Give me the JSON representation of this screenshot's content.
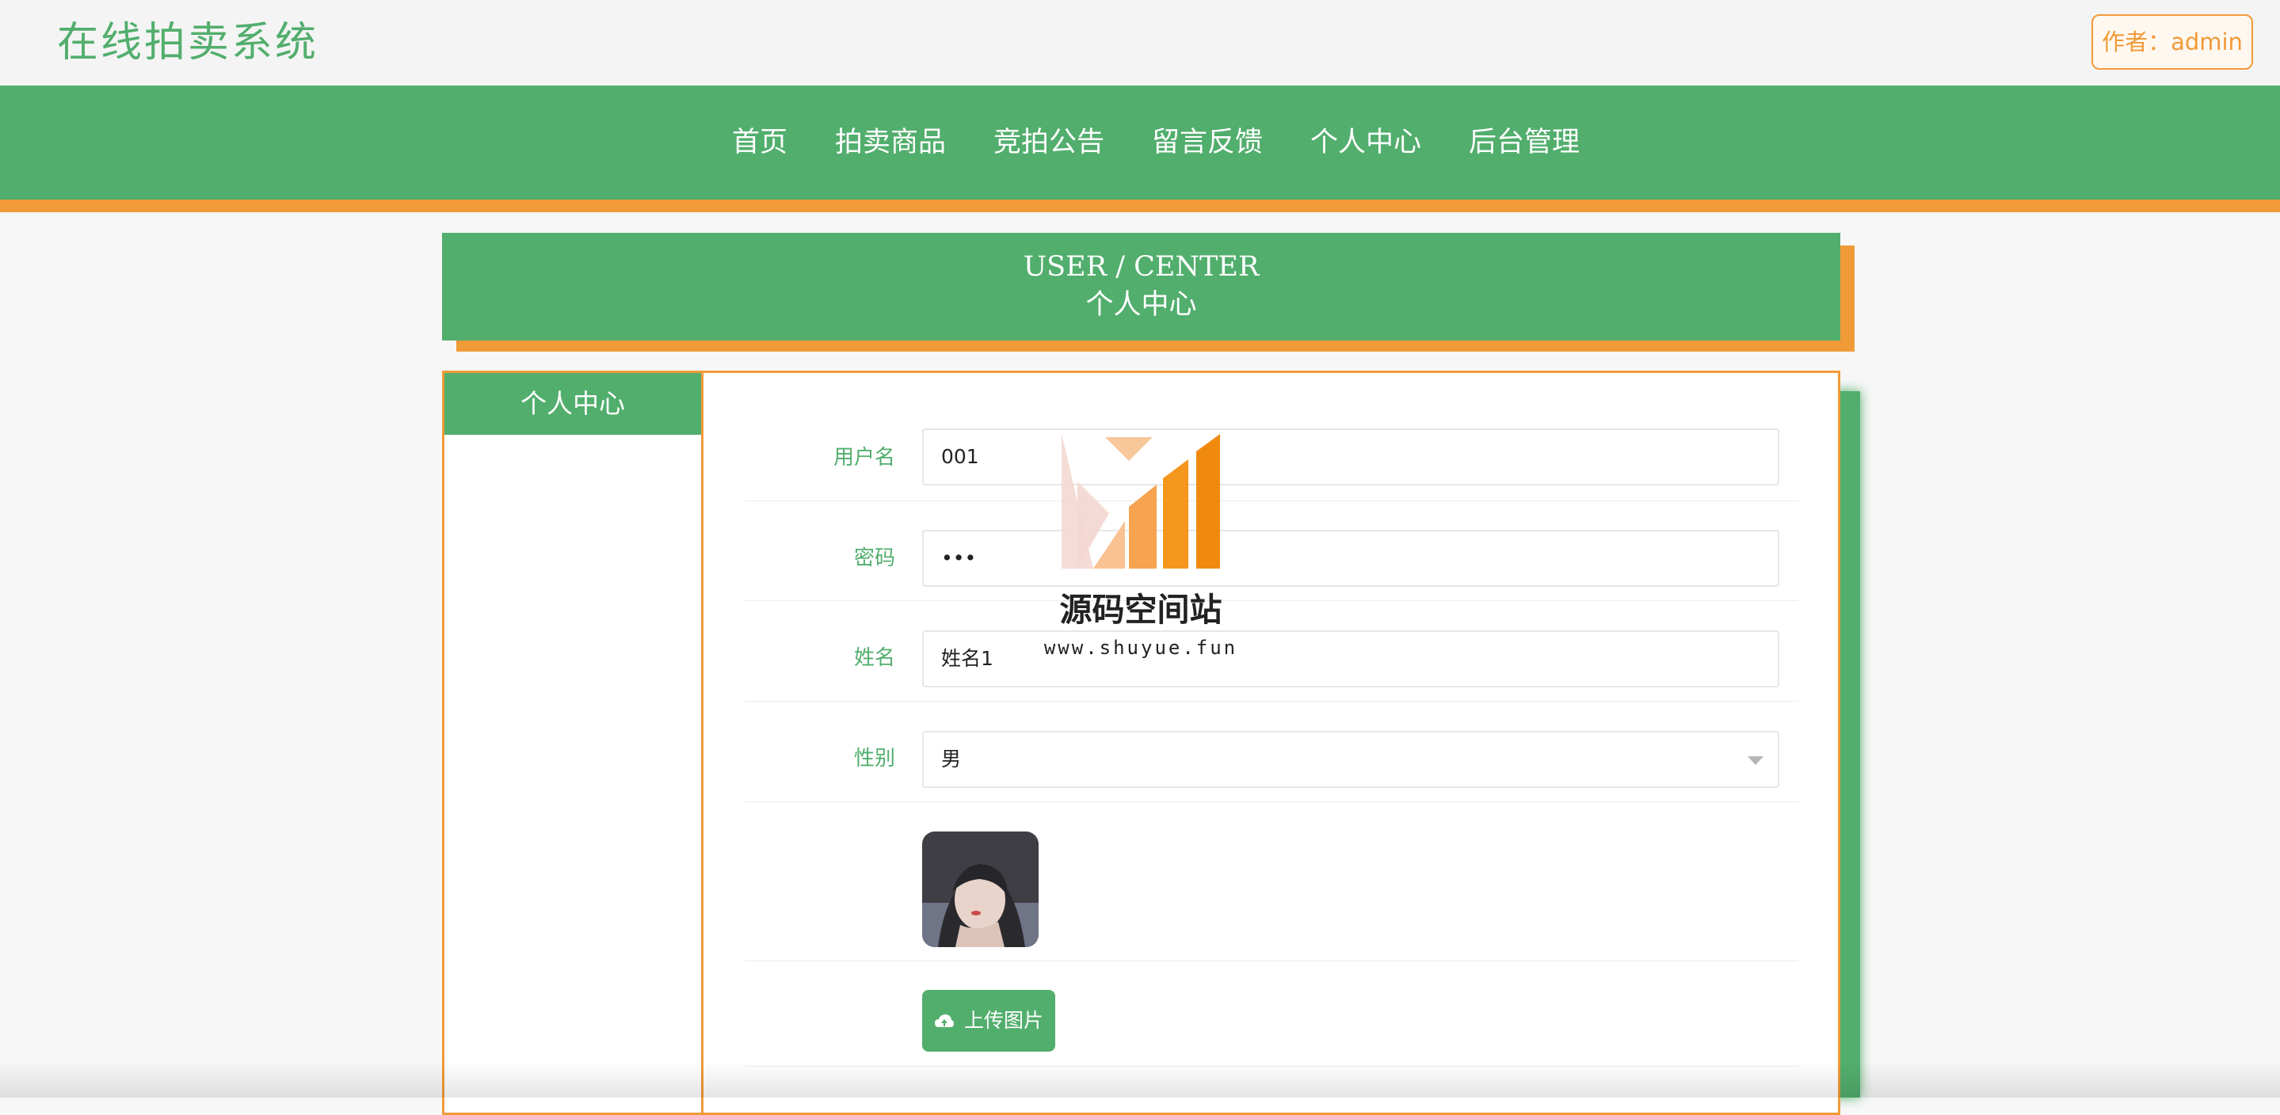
{
  "header": {
    "site_title": "在线拍卖系统",
    "author_label": "作者：admin"
  },
  "nav": {
    "items": [
      "首页",
      "拍卖商品",
      "竞拍公告",
      "留言反馈",
      "个人中心",
      "后台管理"
    ]
  },
  "banner": {
    "english": "USER / CENTER",
    "chinese": "个人中心"
  },
  "sidebar": {
    "heading": "个人中心"
  },
  "form": {
    "username": {
      "label": "用户名",
      "value": "001"
    },
    "password": {
      "label": "密码",
      "value": "•••"
    },
    "name": {
      "label": "姓名",
      "value": "姓名1"
    },
    "gender": {
      "label": "性别",
      "value": "男"
    },
    "upload_label": "上传图片"
  },
  "watermark": {
    "title": "源码空间站",
    "url": "www.shuyue.fun"
  },
  "colors": {
    "green": "#52ae6d",
    "orange": "#f19a38"
  }
}
